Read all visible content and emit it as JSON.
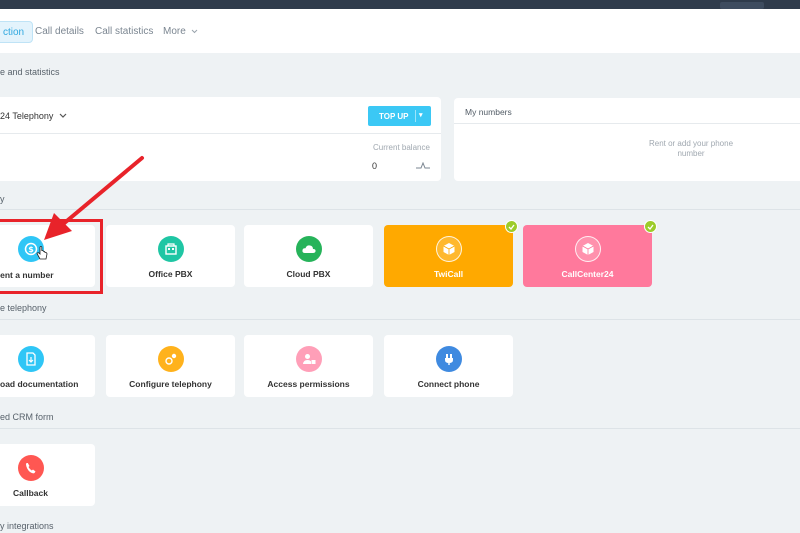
{
  "tabs": [
    {
      "label": "ction",
      "active": true
    },
    {
      "label": "Call details"
    },
    {
      "label": "Call statistics"
    },
    {
      "label": "More"
    }
  ],
  "sections": {
    "balance": "e and statistics",
    "telephony": "y",
    "configure": "e telephony",
    "crm": "ed CRM form",
    "integrations": "y integrations"
  },
  "balance_panel": {
    "provider": "24 Telephony",
    "top_up": "TOP UP",
    "current_balance_label": "Current balance",
    "current_balance_value": "0"
  },
  "my_numbers": {
    "title": "My numbers",
    "empty_text": "Rent or add your phone number"
  },
  "tiles_row1": [
    {
      "label": "Rent a number",
      "icon": "rent-number-icon",
      "color": "#2fc6f6"
    },
    {
      "label": "Office PBX",
      "icon": "office-pbx-icon",
      "color": "#1fc6a4"
    },
    {
      "label": "Cloud PBX",
      "icon": "cloud-pbx-icon",
      "color": "#26b35a"
    },
    {
      "label": "TwiCall",
      "icon": "cube-icon",
      "color": "#ffa900",
      "connected": true
    },
    {
      "label": "CallCenter24",
      "icon": "cube-icon",
      "color": "#ff799c",
      "connected": true
    }
  ],
  "tiles_row2": [
    {
      "label": "oad documentation",
      "icon": "document-icon",
      "color": "#2fc6f6"
    },
    {
      "label": "Configure telephony",
      "icon": "settings-icon",
      "color": "#ffb21c"
    },
    {
      "label": "Access permissions",
      "icon": "user-lock-icon",
      "color": "#ff9fb8"
    },
    {
      "label": "Connect phone",
      "icon": "phone-plug-icon",
      "color": "#3f8ae0"
    }
  ],
  "tiles_row3": [
    {
      "label": "Callback",
      "icon": "callback-icon",
      "color": "#ff5752"
    }
  ],
  "annotation": {
    "color": "#e8232a"
  }
}
